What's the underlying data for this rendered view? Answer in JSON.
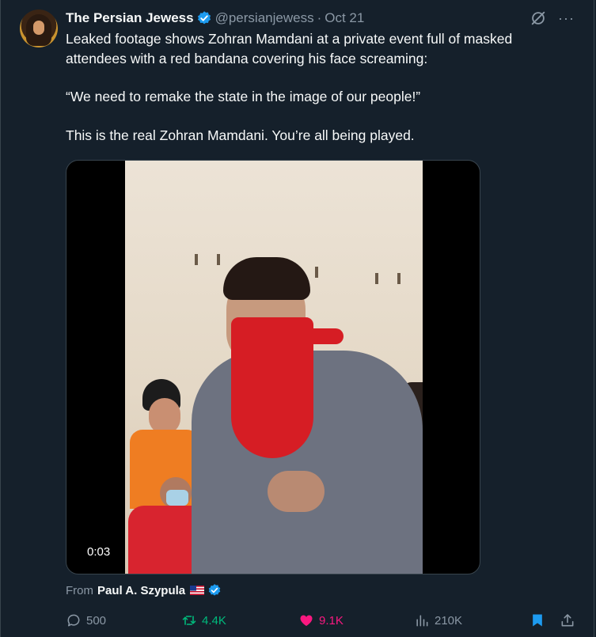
{
  "tweet": {
    "author_name": "The Persian Jewess",
    "handle": "@persianjewess",
    "separator": "·",
    "date": "Oct 21",
    "more_label": "···",
    "text_paragraphs": [
      "Leaked footage shows Zohran Mamdani at a private event full of masked attendees with a red bandana covering his face screaming:",
      "“We need to remake the state in the image of our people!”",
      "This is the real Zohran Mamdani. You’re all being played."
    ],
    "video": {
      "duration": "0:03"
    },
    "attribution": {
      "prefix": "From",
      "name": "Paul A. Szypula"
    }
  },
  "actions": {
    "replies": "500",
    "reposts": "4.4K",
    "likes": "9.1K",
    "views": "210K"
  },
  "colors": {
    "background": "#15202b",
    "text": "#f7f9f9",
    "muted": "#8b98a5",
    "verified": "#1d9bf0",
    "repost": "#00ba7c",
    "like": "#f91880",
    "bookmark": "#1d9bf0"
  }
}
